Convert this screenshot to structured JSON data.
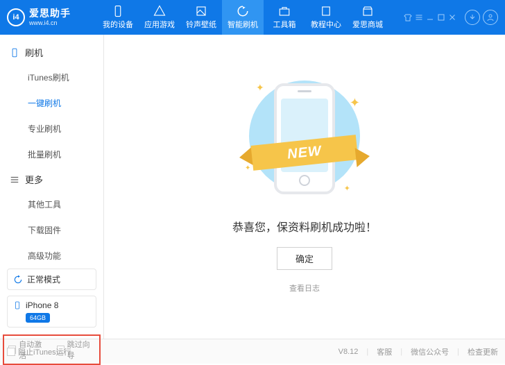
{
  "app": {
    "name": "爱思助手",
    "url": "www.i4.cn",
    "logo_letter": "i4"
  },
  "nav": [
    {
      "label": "我的设备"
    },
    {
      "label": "应用游戏"
    },
    {
      "label": "铃声壁纸"
    },
    {
      "label": "智能刷机"
    },
    {
      "label": "工具箱"
    },
    {
      "label": "教程中心"
    },
    {
      "label": "爱思商城"
    }
  ],
  "sidebar": {
    "g1": {
      "title": "刷机",
      "items": [
        "iTunes刷机",
        "一键刷机",
        "专业刷机",
        "批量刷机"
      ]
    },
    "g2": {
      "title": "更多",
      "items": [
        "其他工具",
        "下载固件",
        "高级功能"
      ]
    },
    "mode": "正常模式",
    "device": {
      "name": "iPhone 8",
      "storage": "64GB"
    },
    "opts": {
      "a": "自动激活",
      "b": "跳过向导"
    }
  },
  "main": {
    "ribbon": "NEW",
    "message": "恭喜您，保资料刷机成功啦！",
    "ok": "确定",
    "log": "查看日志"
  },
  "footer": {
    "block": "阻止iTunes运行",
    "ver": "V8.12",
    "cs": "客服",
    "wx": "微信公众号",
    "upd": "检查更新"
  }
}
